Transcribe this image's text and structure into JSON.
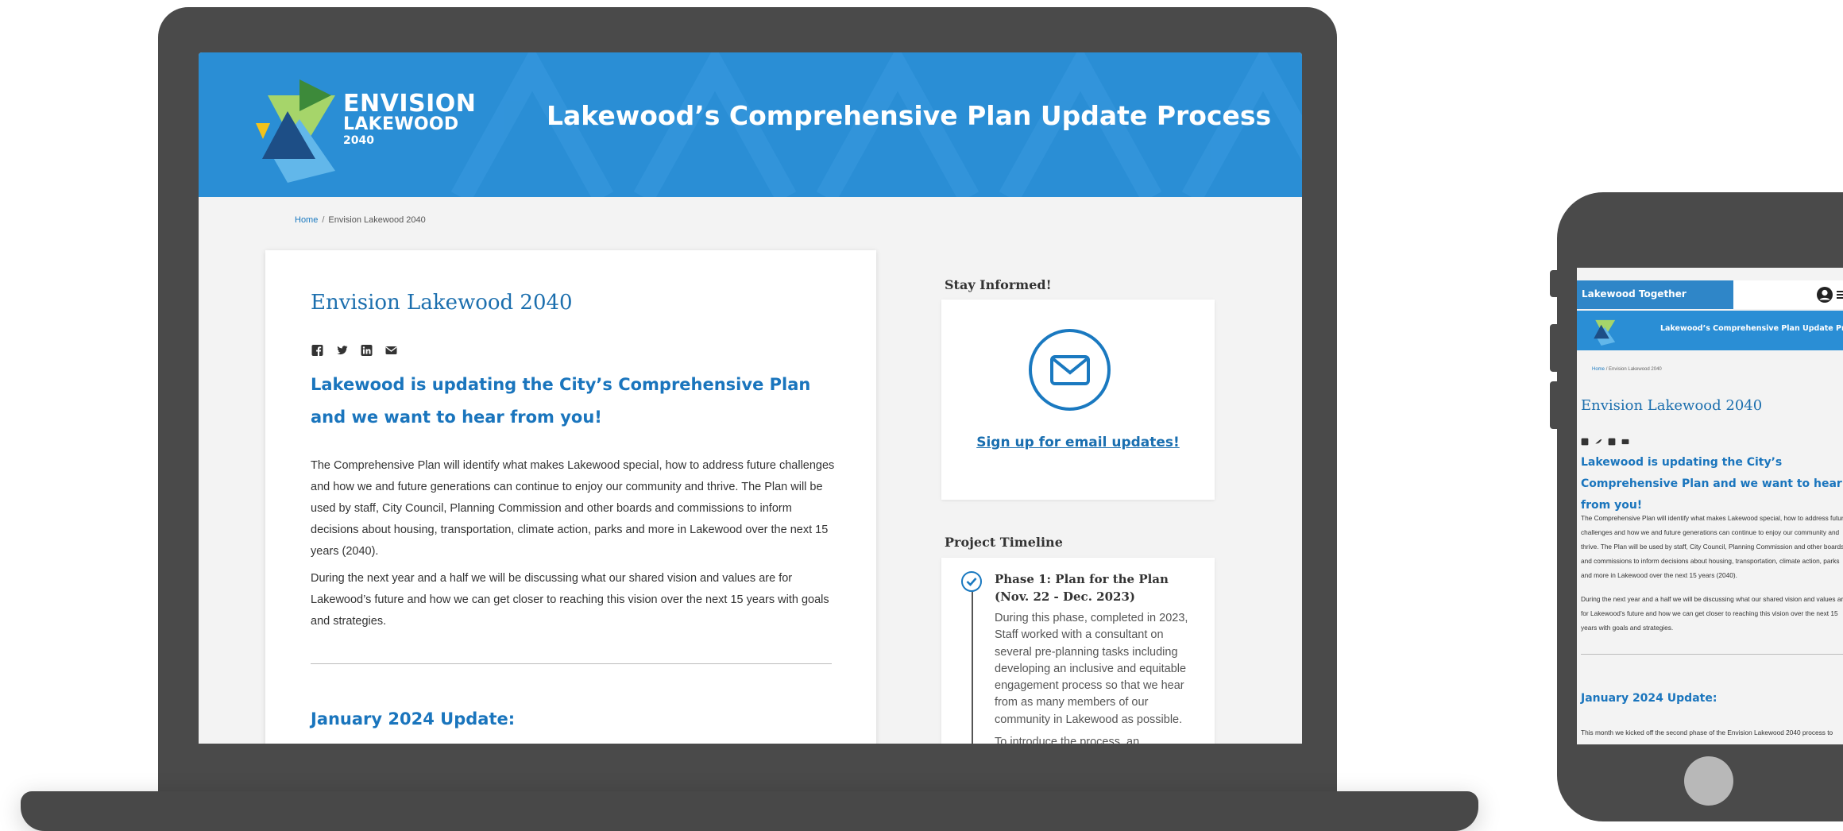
{
  "site": {
    "logo_line1": "ENVISION",
    "logo_line2": "LAKEWOOD",
    "logo_line3": "2040",
    "header_title": "Lakewood’s Comprehensive Plan Update Process"
  },
  "breadcrumb": {
    "home": "Home",
    "separator": "/",
    "current": "Envision Lakewood 2040"
  },
  "page": {
    "title": "Envision Lakewood 2040",
    "share_icons": [
      "facebook-icon",
      "twitter-icon",
      "linkedin-icon",
      "email-icon"
    ],
    "lead": "Lakewood is updating the City’s Comprehensive Plan and we want to hear from you!",
    "body1": "The Comprehensive Plan will identify what makes Lakewood special, how to address future challenges and how we and future generations can continue to enjoy our community and thrive. The Plan will be used by staff, City Council, Planning Commission and other boards and commissions to inform decisions about housing, transportation, climate action, parks and more in Lakewood over the next 15 years (2040).",
    "body2": "During the next year and a half we will be discussing what our shared vision and values are for Lakewood’s future and how we can get closer to reaching this vision over the next 15 years with goals and strategies.",
    "update_heading": "January 2024 Update:"
  },
  "sidebar": {
    "stay_informed_heading": "Stay Informed!",
    "signup_link": "Sign up for email updates!",
    "timeline_heading": "Project Timeline",
    "phase1_title": "Phase 1: Plan for the Plan (Nov. 22 - Dec. 2023)",
    "phase1_desc": "During this phase, completed in 2023, Staff worked with a consultant on several pre-planning tasks including developing an inclusive and equitable engagement process so that we hear from as many members of our community in Lakewood as possible.",
    "phase1_desc_more": "To introduce the process, an"
  },
  "mobile": {
    "brand": "Lakewood Together",
    "update_body": "This month we kicked off the second phase of the Envision Lakewood 2040 process to"
  },
  "colors": {
    "brand_blue": "#2a8ed5",
    "link_blue": "#1a79c0",
    "device_gray": "#4a4a4a"
  }
}
